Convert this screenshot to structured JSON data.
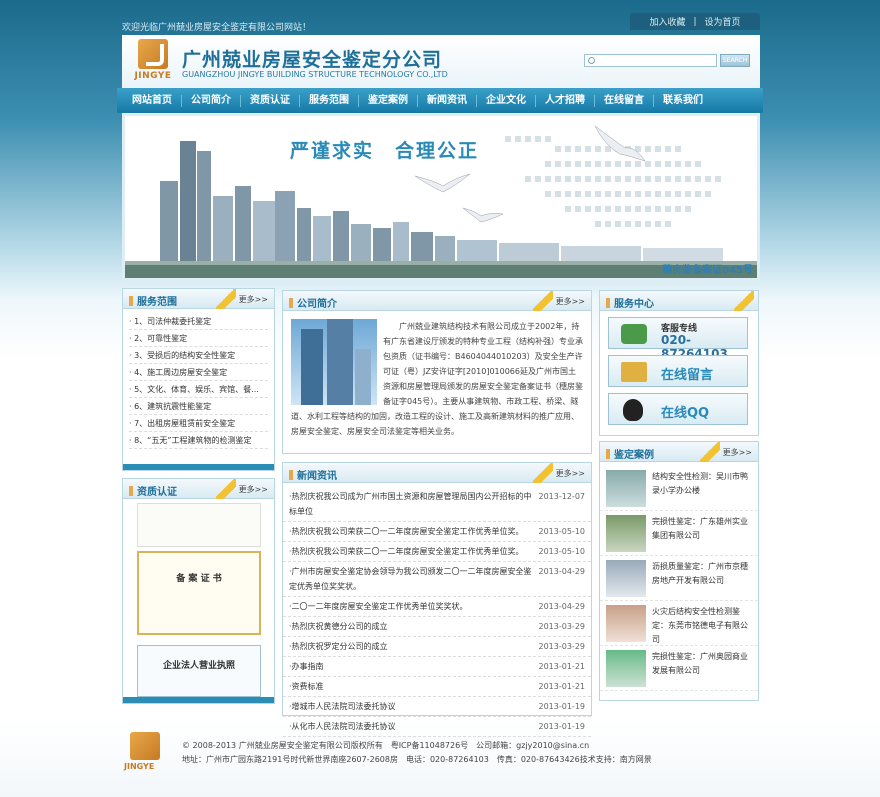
{
  "top": {
    "welcome": "欢迎光临广州兢业房屋安全鉴定有限公司网站！",
    "links": [
      "加入收藏",
      "|",
      "设为首页"
    ]
  },
  "header": {
    "logo_text": "JINGYE",
    "company_cn": "广州兢业房屋安全鉴定分公司",
    "company_en": "GUANGZHOU JINGYE BUILDING STRUCTURE TECHNOLOGY CO.,LTD",
    "search_button": "SEARCH"
  },
  "nav": [
    "网站首页",
    "公司简介",
    "资质认证",
    "服务范围",
    "鉴定案例",
    "新闻资讯",
    "企业文化",
    "人才招聘",
    "在线留言",
    "联系我们"
  ],
  "banner": {
    "slogan": "严谨求实　合理公正",
    "note": "穗房鉴备案证045号"
  },
  "services": {
    "title": "服务范围",
    "more": "更多>>",
    "items": [
      "· 1、司法仲裁委托鉴定",
      "· 2、可靠性鉴定",
      "· 3、受损后的结构安全性鉴定",
      "· 4、施工周边房屋安全鉴定",
      "· 5、文化、体育、娱乐、宾馆、餐...",
      "· 6、建筑抗震性能鉴定",
      "· 7、出租房屋租赁前安全鉴定",
      "· 8、“五无”工程建筑物的检测鉴定"
    ]
  },
  "qualification": {
    "title": "资质认证",
    "more": "更多>>",
    "cert_title": "备 案 证 书",
    "license_title": "企业法人营业执照"
  },
  "about": {
    "title": "公司简介",
    "more": "更多>>",
    "text": "广州兢业建筑结构技术有限公司成立于2002年，持有广东省建设厅颁发的特种专业工程（结构补强）专业承包资质（证书编号：B4604044010203）及安全生产许可证（粤）JZ安许证字[2010]010066延及广州市国土资源和房屋管理局颁发的房屋安全鉴定备案证书（穗房鉴备证字045号）。主要从事建筑物、市政工程、桥梁、隧道、水利工程等结构的加固，改造工程的设计、施工及高新建筑材料的推广应用、房屋安全鉴定、房屋安全司法鉴定等相关业务。"
  },
  "news": {
    "title": "新闻资讯",
    "more": "更多>>",
    "items": [
      {
        "t": "·热烈庆祝我公司成为广州市国土资源和房屋管理局国内公开招标的中标单位",
        "d": "2013-12-07"
      },
      {
        "t": "·热烈庆祝我公司荣获二〇一二年度房屋安全鉴定工作优秀单位奖。",
        "d": "2013-05-10"
      },
      {
        "t": "·热烈庆祝我公司荣获二〇一二年度房屋安全鉴定工作优秀单位奖。",
        "d": "2013-05-10"
      },
      {
        "t": "·广州市房屋安全鉴定协会领导为我公司颁发二〇一二年度房屋安全鉴定优秀单位奖奖状。",
        "d": "2013-04-29"
      },
      {
        "t": "·二〇一二年度房屋安全鉴定工作优秀单位奖奖状。",
        "d": "2013-04-29"
      },
      {
        "t": "·热烈庆祝黄德分公司的成立",
        "d": "2013-03-29"
      },
      {
        "t": "·热烈庆祝罗定分公司的成立",
        "d": "2013-03-29"
      },
      {
        "t": "·办事指南",
        "d": "2013-01-21"
      },
      {
        "t": "·资费标准",
        "d": "2013-01-21"
      },
      {
        "t": "·增城市人民法院司法委托协议",
        "d": "2013-01-19"
      },
      {
        "t": "·从化市人民法院司法委托协议",
        "d": "2013-01-19"
      }
    ]
  },
  "service_center": {
    "title": "服务中心",
    "hotline_label": "客服专线",
    "hotline": "020-87264103",
    "message": "在线留言",
    "qq": "在线QQ"
  },
  "cases": {
    "title": "鉴定案例",
    "more": "更多>>",
    "items": [
      "结构安全性检测：吴川市鸭录小学办公楼",
      "完损性鉴定：广东雄州实业集团有限公司",
      "沥损质量鉴定：广州市京穗房地产开发有限公司",
      "火灾后结构安全性检测鉴定：东莞市铭德电子有限公司",
      "完损性鉴定：广州奥园商业发展有限公司"
    ]
  },
  "footer": {
    "line1": "© 2008-2013 广州兢业房屋安全鉴定有限公司版权所有　粤ICP备11048726号　公司邮箱：gzjy2010@sina.cn",
    "line2": "地址：广州市广园东路2191号时代新世界南座2607-2608房　电话：020-87264103　传真：020-87643426技术支持：南方网景"
  },
  "colors": {
    "primary": "#2a8ab7",
    "accent": "#e8a84a",
    "stripe": "#f2c232"
  }
}
